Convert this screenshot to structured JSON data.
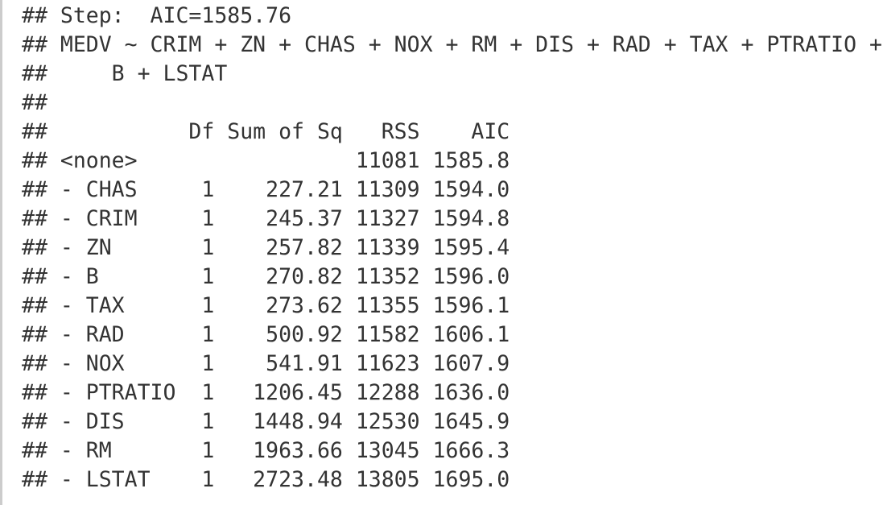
{
  "output": {
    "lines": [
      "## Step:  AIC=1585.76",
      "## MEDV ~ CRIM + ZN + CHAS + NOX + RM + DIS + RAD + TAX + PTRATIO +",
      "##     B + LSTAT",
      "##",
      "##           Df Sum of Sq   RSS    AIC",
      "## <none>                 11081 1585.8",
      "## - CHAS     1    227.21 11309 1594.0",
      "## - CRIM     1    245.37 11327 1594.8",
      "## - ZN       1    257.82 11339 1595.4",
      "## - B        1    270.82 11352 1596.0",
      "## - TAX      1    273.62 11355 1596.1",
      "## - RAD      1    500.92 11582 1606.1",
      "## - NOX      1    541.91 11623 1607.9",
      "## - PTRATIO  1   1206.45 12288 1636.0",
      "## - DIS      1   1448.94 12530 1645.9",
      "## - RM       1   1963.66 13045 1666.3",
      "## - LSTAT    1   2723.48 13805 1695.0"
    ]
  },
  "colors": {
    "text": "#333333",
    "border": "#cccccc",
    "background": "#ffffff"
  }
}
